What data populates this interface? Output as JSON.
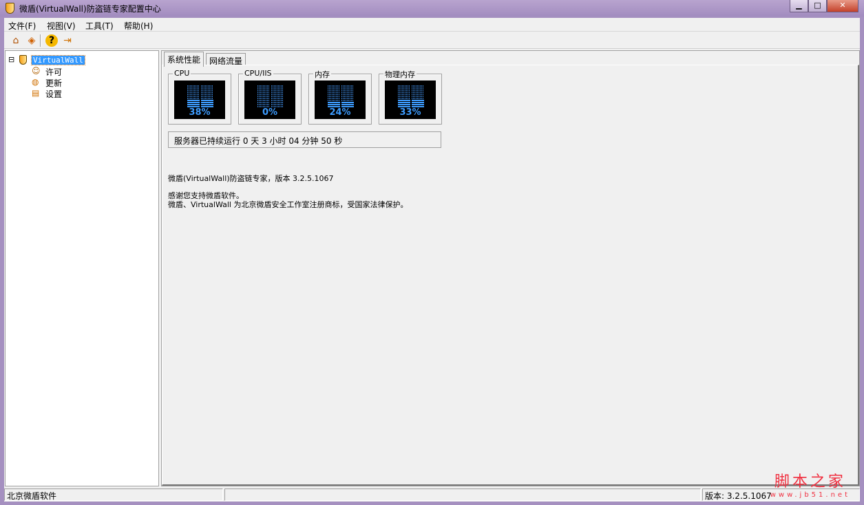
{
  "window": {
    "title": "微盾(VirtualWall)防盗链专家配置中心",
    "min": "▁",
    "max": "□",
    "close": "✕"
  },
  "menu": [
    "文件(F)",
    "视图(V)",
    "工具(T)",
    "帮助(H)"
  ],
  "toolbar": [
    {
      "icon": "home-icon",
      "glyph": "⌂"
    },
    {
      "icon": "firewall-icon",
      "glyph": "◈"
    },
    {
      "icon": "help-icon",
      "glyph": "?"
    },
    {
      "icon": "exit-icon",
      "glyph": "⇥"
    }
  ],
  "tree": {
    "root": "VirtualWall",
    "expander": "⊟",
    "children": [
      "许可",
      "更新",
      "设置"
    ]
  },
  "tabs": [
    "系统性能",
    "网络流量"
  ],
  "meters": [
    {
      "label": "CPU",
      "percent": 38,
      "text": "38%"
    },
    {
      "label": "CPU/IIS",
      "percent": 0,
      "text": "0%"
    },
    {
      "label": "内存",
      "percent": 24,
      "text": "24%"
    },
    {
      "label": "物理内存",
      "percent": 33,
      "text": "33%"
    }
  ],
  "uptime": "服务器已持续运行 0 天 3 小时 04 分钟 50 秒",
  "info": [
    "微盾(VirtualWall)防盗链专家，版本 3.2.5.1067",
    "感谢您支持微盾软件。",
    "微盾、VirtualWall 为北京微盾安全工作室注册商标，受国家法律保护。"
  ],
  "status": {
    "left": "北京微盾软件",
    "middle": "",
    "right": "版本: 3.2.5.1067"
  },
  "watermark": {
    "title": "脚本之家",
    "url": "www.jb51.net"
  }
}
